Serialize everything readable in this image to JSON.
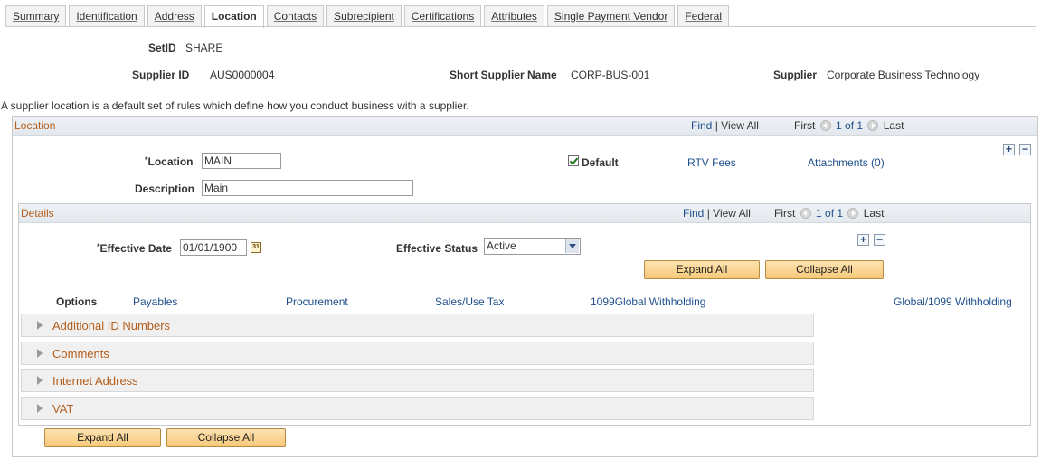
{
  "tabs": [
    {
      "label": "Summary",
      "active": false
    },
    {
      "label": "Identification",
      "active": false
    },
    {
      "label": "Address",
      "active": false
    },
    {
      "label": "Location",
      "active": true
    },
    {
      "label": "Contacts",
      "active": false
    },
    {
      "label": "Subrecipient",
      "active": false
    },
    {
      "label": "Certifications",
      "active": false
    },
    {
      "label": "Attributes",
      "active": false
    },
    {
      "label": "Single Payment Vendor",
      "active": false
    },
    {
      "label": "Federal",
      "active": false
    }
  ],
  "header": {
    "setid_label": "SetID",
    "setid_value": "SHARE",
    "supplier_id_label": "Supplier ID",
    "supplier_id_value": "AUS0000004",
    "short_name_label": "Short Supplier Name",
    "short_name_value": "CORP-BUS-001",
    "supplier_label": "Supplier",
    "supplier_value": "Corporate Business Technology"
  },
  "intro_text": "A supplier location is a default set of rules which define how you conduct business with a supplier.",
  "location_grid": {
    "title": "Location",
    "find": "Find",
    "sep": "|",
    "view_all": "View All",
    "first": "First",
    "count": "1 of 1",
    "last": "Last",
    "location_label": "Location",
    "location_value": "MAIN",
    "description_label": "Description",
    "description_value": "Main",
    "default_label": "Default",
    "rtv_fees": "RTV Fees",
    "attachments": "Attachments (0)"
  },
  "details_grid": {
    "title": "Details",
    "find": "Find",
    "sep": "|",
    "view_all": "View All",
    "first": "First",
    "count": "1 of 1",
    "last": "Last",
    "eff_date_label": "Effective Date",
    "eff_date_value": "01/01/1900",
    "eff_status_label": "Effective Status",
    "eff_status_value": "Active",
    "expand_all": "Expand All",
    "collapse_all": "Collapse All",
    "options_label": "Options",
    "option_links": [
      "Payables",
      "Procurement",
      "Sales/Use Tax",
      "1099Global Withholding",
      "Global/1099 Withholding"
    ],
    "sections": [
      "Additional ID Numbers",
      "Comments",
      "Internet Address",
      "VAT"
    ]
  },
  "footer": {
    "expand_all": "Expand All",
    "collapse_all": "Collapse All"
  },
  "icons": {
    "required_marker": "*",
    "plus": "+",
    "minus": "−",
    "calendar": "31"
  },
  "colors": {
    "link": "#1e4f8c",
    "section_title": "#b35e1c",
    "button_bg": "#f6c978"
  }
}
